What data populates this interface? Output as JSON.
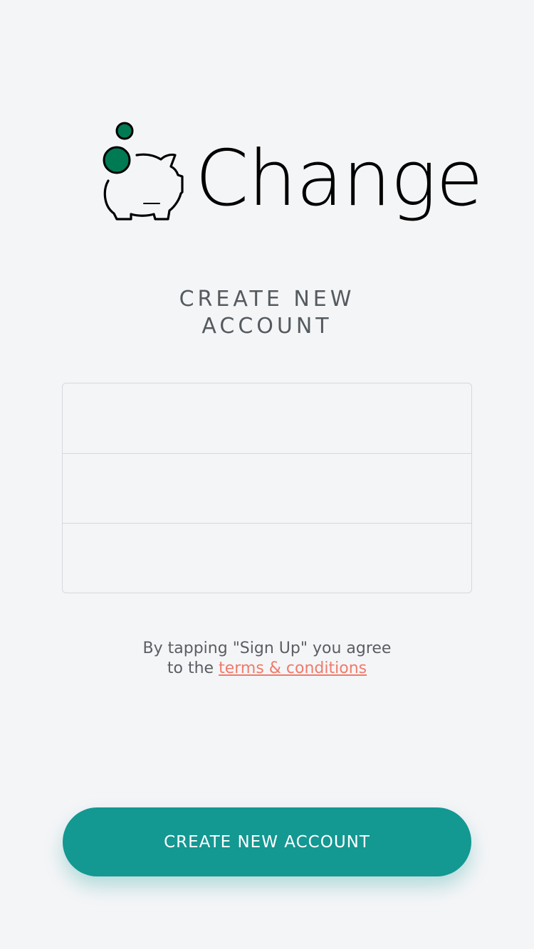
{
  "app": {
    "name": "Change",
    "logo_icon": "piggy-bank-with-coins"
  },
  "heading": {
    "line1": "CREATE NEW",
    "line2": "ACCOUNT"
  },
  "form": {
    "fields": [
      {
        "value": "",
        "placeholder": ""
      },
      {
        "value": "",
        "placeholder": ""
      },
      {
        "value": "",
        "placeholder": ""
      }
    ]
  },
  "terms": {
    "line1": "By tapping \"Sign Up\" you agree",
    "line2_prefix": "to the ",
    "link_label": "terms & conditions"
  },
  "cta": {
    "label": "CREATE NEW ACCOUNT"
  },
  "colors": {
    "background": "#f4f5f7",
    "accent": "#139892",
    "coin_green": "#007a53",
    "link": "#f07a6a",
    "text_muted": "#555a5e"
  }
}
